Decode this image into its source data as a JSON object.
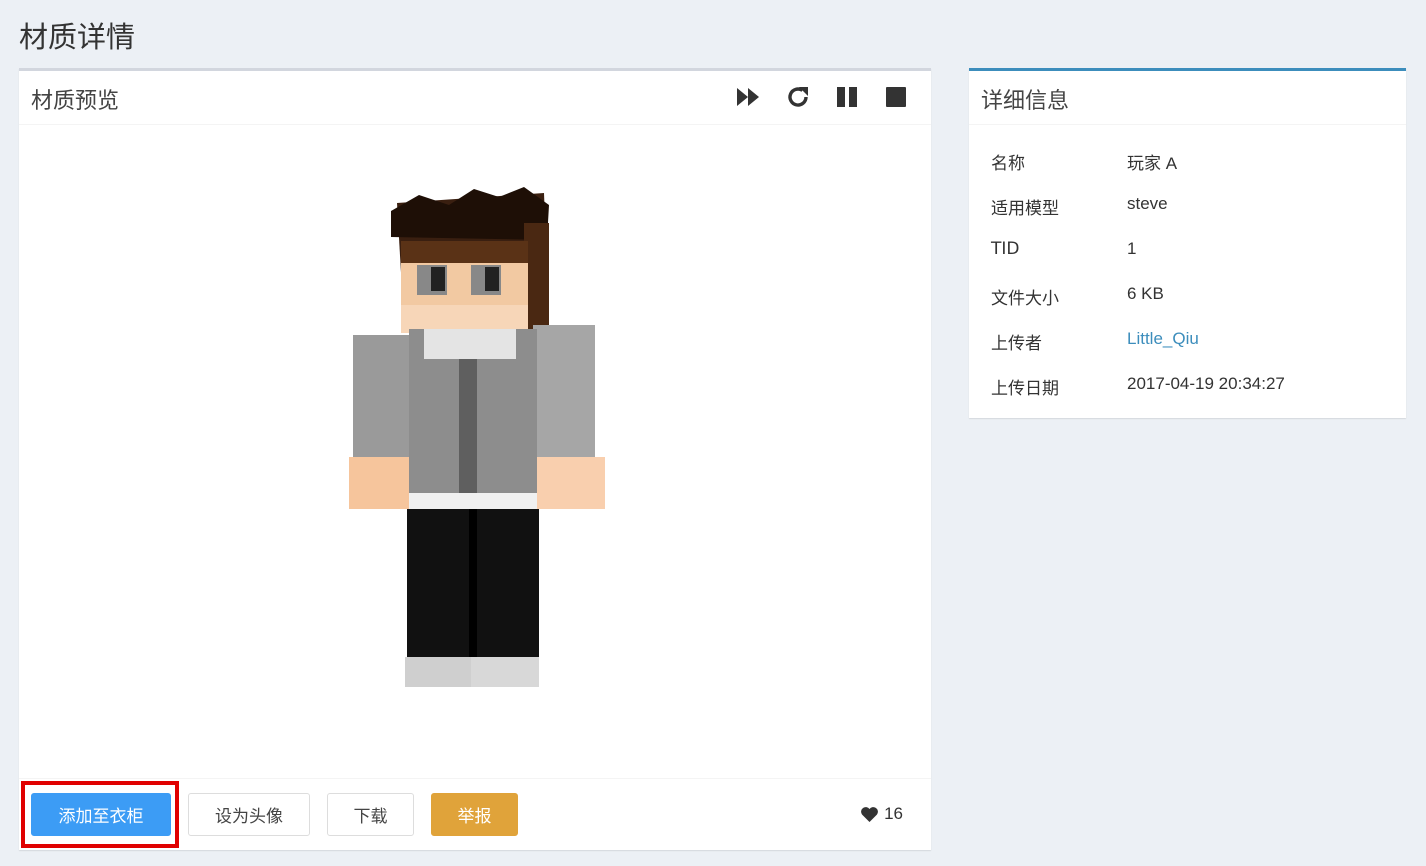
{
  "page": {
    "title": "材质详情"
  },
  "preview": {
    "title": "材质预览",
    "tools": [
      "fast-forward-icon",
      "redo-icon",
      "pause-icon",
      "stop-icon"
    ],
    "buttons": {
      "add_to_closet": "添加至衣柜",
      "set_avatar": "设为头像",
      "download": "下载",
      "report": "举报"
    },
    "likes": "16"
  },
  "info": {
    "title": "详细信息",
    "rows": [
      {
        "key": "名称",
        "value": "玩家 A"
      },
      {
        "key": "适用模型",
        "value": "steve"
      },
      {
        "key": "TID",
        "value": "1"
      },
      {
        "key": "文件大小",
        "value": "6 KB"
      },
      {
        "key": "上传者",
        "value": "Little_Qiu"
      },
      {
        "key": "上传日期",
        "value": "2017-04-19 20:34:27"
      }
    ]
  },
  "colors": {
    "primary": "#3c9cf5",
    "warning": "#e0a33a",
    "link": "#3c8dbc",
    "highlight": "#e00000"
  }
}
